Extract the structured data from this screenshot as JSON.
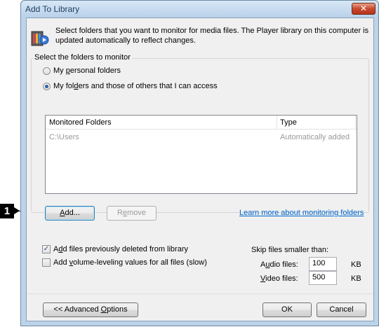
{
  "window": {
    "title": "Add To Library",
    "close_label": "✕"
  },
  "header": {
    "icon": "library-icon",
    "description": "Select folders that you want to monitor for media files. The Player library on this computer is updated automatically to reflect changes."
  },
  "folders_group": {
    "legend": "Select the folders to monitor",
    "options": [
      {
        "label_pre": "My ",
        "label_accel": "p",
        "label_post": "ersonal folders",
        "checked": false
      },
      {
        "label_pre": "My fol",
        "label_accel": "d",
        "label_post": "ers and those of others that I can access",
        "checked": true
      }
    ],
    "list": {
      "columns": [
        "Monitored Folders",
        "Type"
      ],
      "rows": [
        {
          "folder": "C:\\Users",
          "type": "Automatically added"
        }
      ]
    },
    "add_button": {
      "pre": "",
      "accel": "A",
      "post": "dd..."
    },
    "remove_button": {
      "pre": "R",
      "accel": "e",
      "post": "move"
    },
    "learn_more_link": "Learn more about monitoring folders"
  },
  "options": {
    "deleted_files": {
      "pre": "A",
      "accel": "d",
      "post": "d files previously deleted from library",
      "checked": true
    },
    "volume_leveling": {
      "pre": "Add ",
      "accel": "v",
      "post": "olume-leveling values for all files (slow)",
      "checked": false
    },
    "skip_label": "Skip files smaller than:",
    "audio_label": {
      "pre": "A",
      "accel": "u",
      "post": "dio files:"
    },
    "audio_value": "100",
    "video_label": {
      "pre": "",
      "accel": "V",
      "post": "ideo files:"
    },
    "video_value": "500",
    "unit": "KB"
  },
  "footer": {
    "advanced": {
      "pre": "<< Advanced ",
      "accel": "O",
      "post": "ptions"
    },
    "ok": "OK",
    "cancel": "Cancel"
  },
  "callout": {
    "number": "1"
  },
  "colors": {
    "accent": "#0066cc",
    "title_bar": "#bcd3ea"
  }
}
